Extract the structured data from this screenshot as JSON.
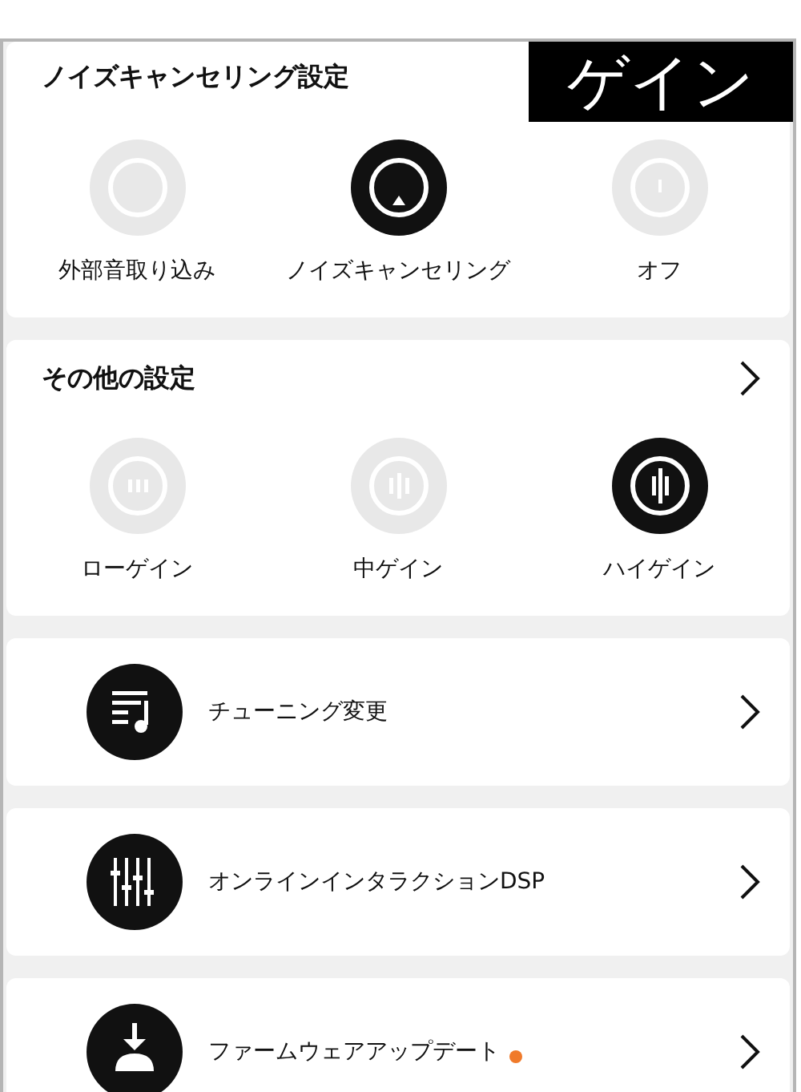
{
  "caption": "ゲイン",
  "noise_cancelling": {
    "title": "ノイズキャンセリング設定",
    "options": [
      {
        "label": "外部音取り込み",
        "kind": "ambient",
        "selected": false
      },
      {
        "label": "ノイズキャンセリング",
        "kind": "anc",
        "selected": true
      },
      {
        "label": "オフ",
        "kind": "off",
        "selected": false
      }
    ]
  },
  "other_settings": {
    "title": "その他の設定",
    "options": [
      {
        "label": "ローゲイン",
        "kind": "low",
        "selected": false
      },
      {
        "label": "中ゲイン",
        "kind": "mid",
        "selected": false
      },
      {
        "label": "ハイゲイン",
        "kind": "high",
        "selected": true
      }
    ]
  },
  "menu_items": [
    {
      "label": "チューニング変更",
      "kind": "tuning",
      "update_available": false
    },
    {
      "label": "オンラインインタラクションDSP",
      "kind": "dsp",
      "update_available": false
    },
    {
      "label": "ファームウェアアップデート",
      "kind": "firmware",
      "update_available": true
    }
  ]
}
